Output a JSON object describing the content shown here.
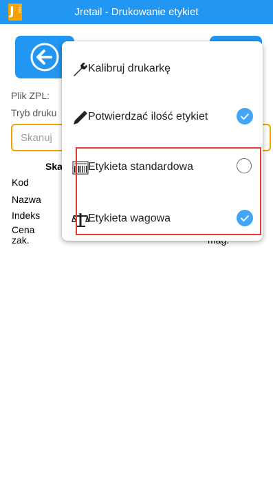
{
  "titlebar": {
    "logo_letter": "J",
    "logo_small": "retail",
    "title": "Jretail - Drukowanie etykiet"
  },
  "form": {
    "plik_label": "Plik ZPL:",
    "tryb_label": "Tryb druku",
    "scan_placeholder": "Skanuj",
    "section_label": "Ska",
    "kod_label": "Kod",
    "nazwa_label": "Nazwa",
    "indeks_label": "Indeks",
    "cena_label": "Cena",
    "cena_sub_label": "zak.",
    "mag_label": "mag."
  },
  "menu": {
    "items": [
      {
        "label": "Kalibruj drukarkę",
        "icon": "wrench-icon",
        "control": "none"
      },
      {
        "label": "Potwierdzać ilość etykiet",
        "icon": "pen-icon",
        "control": "checked"
      },
      {
        "label": "Etykieta standardowa",
        "icon": "barcode-icon",
        "control": "radio-unchecked"
      },
      {
        "label": "Etykieta wagowa",
        "icon": "scale-icon",
        "control": "radio-checked"
      }
    ]
  },
  "colors": {
    "primary": "#2196f3",
    "accent": "#f5a200",
    "check": "#42a5f5",
    "highlight": "#e53935"
  }
}
